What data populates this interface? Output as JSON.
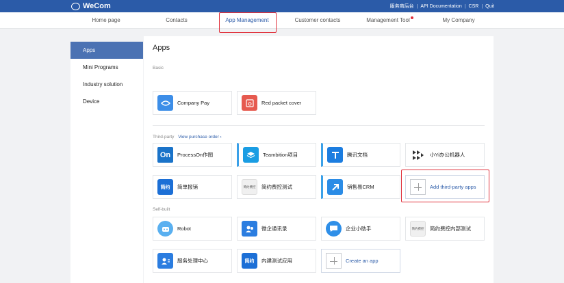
{
  "brand": {
    "name": "WeCom"
  },
  "toplinks": [
    "服务商后台",
    "API Documentation",
    "CSR",
    "Quit"
  ],
  "nav": {
    "items": [
      "Home page",
      "Contacts",
      "App Management",
      "Customer contacts",
      "Management Tool",
      "My Company"
    ],
    "active": "App Management"
  },
  "sidebar": {
    "items": [
      "Apps",
      "Mini Programs",
      "Industry solution",
      "Device"
    ]
  },
  "main": {
    "title": "Apps",
    "basic_label": "Basic",
    "basic": [
      {
        "label": "Company Pay",
        "icon": "wallet-icon",
        "color": "#3d8ee8"
      },
      {
        "label": "Red packet cover",
        "icon": "red-packet-icon",
        "color": "#e65a4f"
      }
    ],
    "third_label": "Third-party",
    "third_link": "View purchase order ›",
    "third": [
      {
        "label": "ProcessOn作图",
        "icon_text": "On",
        "color": "#1a73c9"
      },
      {
        "label": "Teambition项目",
        "icon": "layers-icon",
        "color": "#1a9de3"
      },
      {
        "label": "腾讯文档",
        "icon": "doc-icon",
        "color": "#1c7de0"
      },
      {
        "label": "小Yi办公机器人",
        "icon": "robot-arrows-icon",
        "color": "#333333"
      },
      {
        "label": "简单报销",
        "icon_text": "简约",
        "color": "#1c6fd6"
      },
      {
        "label": "简约费控测试",
        "icon_text": "简约费控",
        "color": "#f0f0f0"
      },
      {
        "label": "销售易CRM",
        "icon": "arrow-up-icon",
        "color": "#2b8ce6"
      }
    ],
    "add_third": "Add third-party apps",
    "self_label": "Self-built",
    "self": [
      {
        "label": "Robot",
        "icon": "bot-icon",
        "color": "#5ab0f0"
      },
      {
        "label": "微企通讯录",
        "icon": "contacts-icon",
        "color": "#2b7de0"
      },
      {
        "label": "企业小助手",
        "icon": "chat-icon",
        "color": "#2f8fe8"
      },
      {
        "label": "简约费控内部测试",
        "icon_text": "简约费控",
        "color": "#f0f0f0"
      },
      {
        "label": "服务处理中心",
        "icon": "service-icon",
        "color": "#2b7de0"
      },
      {
        "label": "内建测试应用",
        "icon_text": "简约",
        "color": "#1c6fd6"
      }
    ],
    "create_app": "Create an app"
  }
}
